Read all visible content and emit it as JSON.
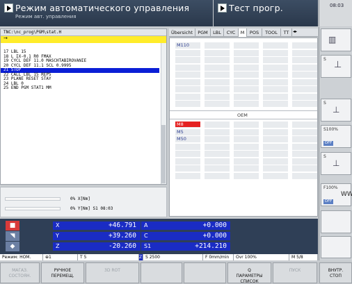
{
  "header": {
    "mode_title": "Режим автоматического управления",
    "mode_subtitle": "Режим авт. управления",
    "secondary_mode": "Тест прогр.",
    "clock": "08:03"
  },
  "program": {
    "path": "TNC:\\nc_prog\\PGM\\stat.H",
    "cursor_marker": "→",
    "lines": [
      "17 LBL 15",
      "18 L IX-0.1 R0 FMAX",
      "19 CYCL DEF 11.0 MASCHTABIROVANIE",
      "20 CYCL DEF 11.1 SCL 0.9995",
      "21 STOP",
      "22 CALL LBL 15 REP5",
      "23 PLANE RESET STAY",
      "24 LBL 0",
      "25 END PGM STAT1 MM"
    ],
    "highlighted_index": 4
  },
  "load": {
    "bar1_label": "0% X[Nm]",
    "bar2_label": "0% Y[Nm] S1   08:03"
  },
  "status_tabs": [
    {
      "label": "Übersicht",
      "active": false
    },
    {
      "label": "PGM",
      "active": false
    },
    {
      "label": "LBL",
      "active": false
    },
    {
      "label": "CYC",
      "active": false
    },
    {
      "label": "M",
      "active": true
    },
    {
      "label": "POS",
      "active": false
    },
    {
      "label": "TOOL",
      "active": false
    },
    {
      "label": "TT",
      "active": false
    }
  ],
  "mfunctions": {
    "top_codes": [
      "M110"
    ],
    "oem_label": "OEM",
    "oem_codes": [
      "M8",
      "M5",
      "M50"
    ]
  },
  "positions": [
    {
      "axis": "X",
      "value": "+46.791",
      "axis2": "A",
      "value2": "+0.000"
    },
    {
      "axis": "Y",
      "value": "+39.260",
      "axis2": "C",
      "value2": "+0.000"
    },
    {
      "axis": "Z",
      "value": "-20.260",
      "axis2": "S1",
      "value2": "+214.210"
    }
  ],
  "status_bar": {
    "mode": "Режим: НОМ.",
    "tool_label": "1",
    "t": "T 5",
    "z": "Z",
    "s": "S 2500",
    "f": "F 0mm/min",
    "ovr": "Ovr 100%",
    "m": "M 5/8"
  },
  "side": {
    "s_label": "S",
    "s100": "S100%",
    "f100": "F100%",
    "off": "OFF",
    "ww": "WW"
  },
  "softkeys": [
    {
      "label": "МАГАЗ.\nСОСТОЯН.",
      "dim": true
    },
    {
      "label": "РУЧНОЕ\nПЕРЕМЕЩ.",
      "dim": false
    },
    {
      "label": "3D ROT",
      "dim": true
    },
    {
      "label": "",
      "dim": false
    },
    {
      "label": "",
      "dim": false
    },
    {
      "label": "Q\nПАРАМЕТРЫ\nСПИСОК",
      "dim": false
    },
    {
      "label": "ПУСК",
      "dim": true
    },
    {
      "label": "ВНУТР.\nСТОП",
      "dim": false
    }
  ],
  "colors": {
    "header_bg": "#2a384b",
    "axis_bg": "#1a2cc4",
    "highlight": "#0b1fd6",
    "cursor_bar": "#ffec2a",
    "m8_bg": "#e52121"
  }
}
